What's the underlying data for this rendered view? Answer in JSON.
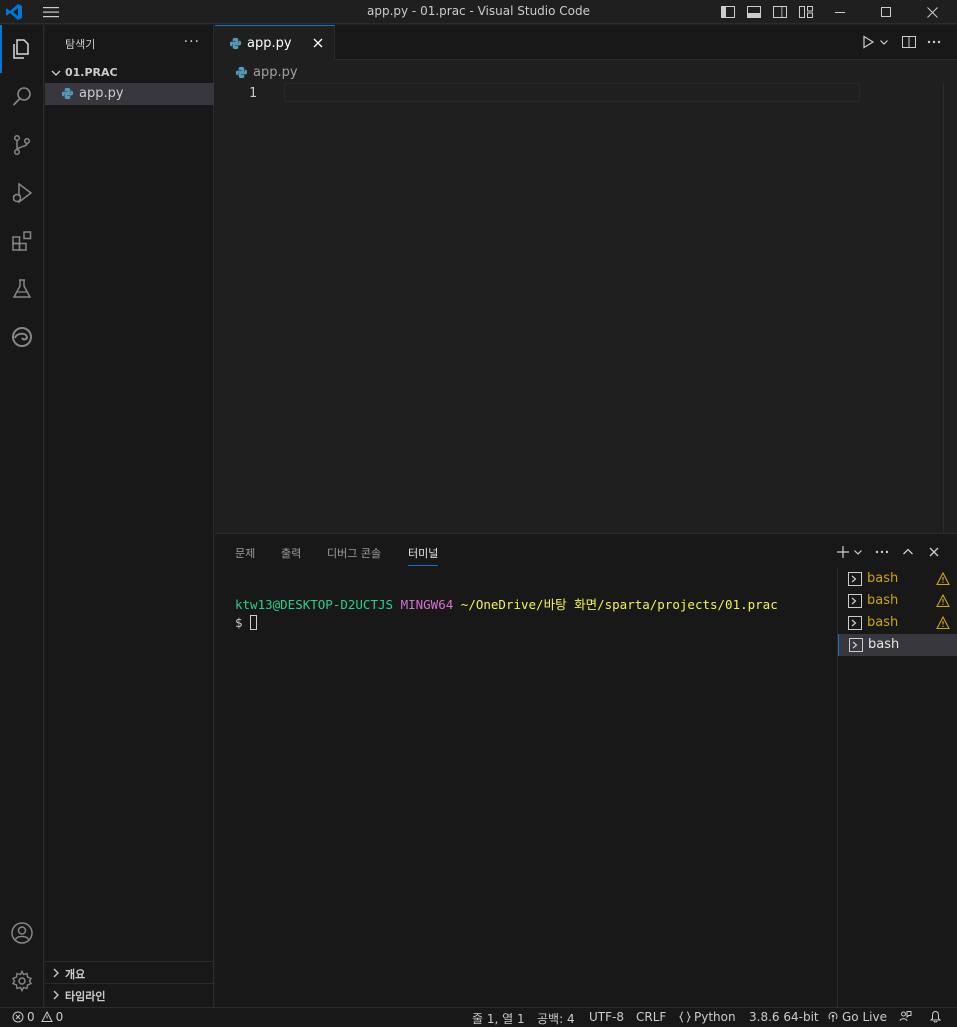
{
  "window": {
    "title": "app.py - 01.prac - Visual Studio Code"
  },
  "colors": {
    "accent": "#0078d4",
    "python_blue": "#519aba",
    "warning": "#cca700",
    "terminal_user": "#23d18b",
    "terminal_host": "#d670d6",
    "terminal_path": "#f5f543"
  },
  "activity_bar": {
    "items": [
      "explorer-icon",
      "search-icon",
      "source-control-icon",
      "run-debug-icon",
      "extensions-icon",
      "testing-icon",
      "edge-icon"
    ],
    "bottom": [
      "account-icon",
      "settings-gear-icon"
    ]
  },
  "sidebar": {
    "title": "탐색기",
    "more": "···",
    "folder": "01.PRAC",
    "file": "app.py",
    "sections": [
      "개요",
      "타임라인"
    ]
  },
  "editor": {
    "tab_label": "app.py",
    "breadcrumb": "app.py",
    "line_number": "1"
  },
  "panel": {
    "tabs": [
      "문제",
      "출력",
      "디버그 콘솔",
      "터미널"
    ],
    "active_tab": "터미널",
    "terminal": {
      "user_host": "ktw13@DESKTOP-D2UCTJS",
      "system": "MINGW64",
      "path": "~/OneDrive/바탕 화면/sparta/projects/01.prac",
      "prompt": "$"
    },
    "terminals": [
      {
        "label": "bash",
        "warning": true
      },
      {
        "label": "bash",
        "warning": true
      },
      {
        "label": "bash",
        "warning": true
      },
      {
        "label": "bash",
        "warning": false
      }
    ]
  },
  "status_bar": {
    "errors": "0",
    "warnings": "0",
    "position": "줄 1, 열 1",
    "indent": "공백: 4",
    "encoding": "UTF-8",
    "eol": "CRLF",
    "language": "Python",
    "interpreter": "3.8.6 64-bit",
    "go_live": "Go Live"
  }
}
